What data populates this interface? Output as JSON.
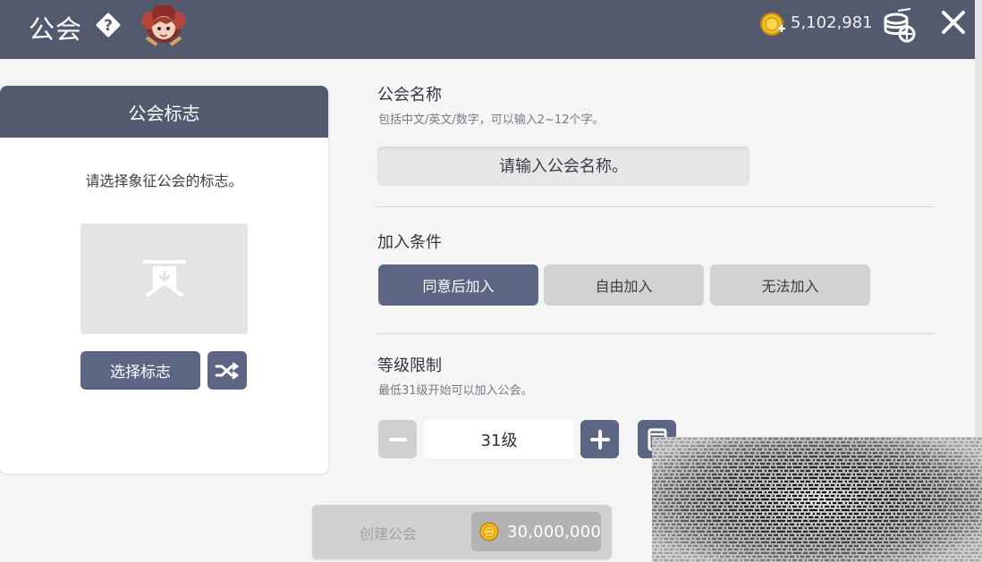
{
  "header": {
    "title": "公会",
    "gold": "5,102,981"
  },
  "icons": {
    "help": "help-diamond-icon",
    "avatar": "character-avatar",
    "coin": "gold-coin-icon",
    "currency": "coin-stack-icon",
    "close": "close-icon",
    "emblem": "banner-emblem-icon",
    "shuffle": "shuffle-icon",
    "minus": "minus-icon",
    "plus": "plus-icon",
    "calculator": "calculator-icon"
  },
  "emblem_panel": {
    "title": "公会标志",
    "instruction": "请选择象征公会的标志。",
    "select_button": "选择标志"
  },
  "guild_name": {
    "title": "公会名称",
    "hint": "包括中文/英文/数字，可以输入2~12个字。",
    "placeholder": "请输入公会名称。"
  },
  "join_conditions": {
    "title": "加入条件",
    "options": [
      {
        "label": "同意后加入",
        "active": true
      },
      {
        "label": "自由加入",
        "active": false
      },
      {
        "label": "无法加入",
        "active": false
      }
    ]
  },
  "level_limit": {
    "title": "等级限制",
    "hint": "最低31级开始可以加入公会。",
    "value": "31级"
  },
  "create": {
    "label": "创建公会",
    "cost": "30,000,000"
  },
  "colors": {
    "header": "#535a6e",
    "primary_button": "#5c6684",
    "inactive_button": "#d2d2d2",
    "background": "#f5f5f5"
  }
}
